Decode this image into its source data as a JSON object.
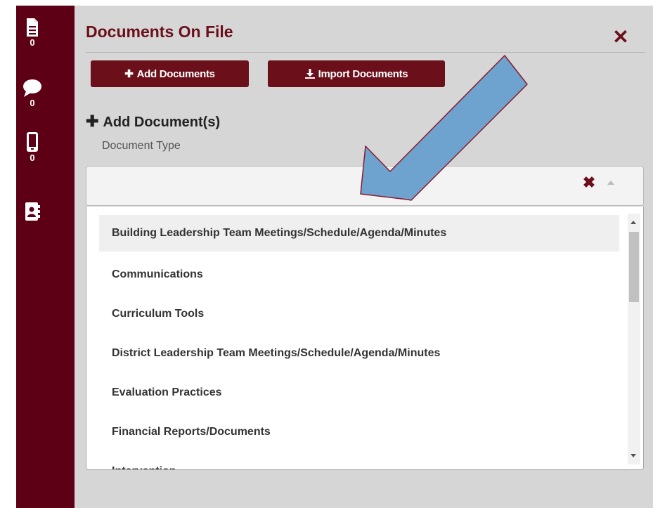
{
  "sidebar": {
    "documents_count": "0",
    "messages_count": "0",
    "mobile_count": "0"
  },
  "panel": {
    "title": "Documents On File",
    "close_glyph": "✕"
  },
  "buttons": {
    "add_documents": "Add Documents",
    "import_documents": "Import Documents"
  },
  "section": {
    "title": "Add Document(s)",
    "document_type_label": "Document Type"
  },
  "select": {
    "clear_glyph": "✖",
    "options": [
      "Building Leadership Team Meetings/Schedule/Agenda/Minutes",
      "Communications",
      "Curriculum Tools",
      "District Leadership Team Meetings/Schedule/Agenda/Minutes",
      "Evaluation Practices",
      "Financial Reports/Documents",
      "Intervention"
    ],
    "highlighted_index": 0
  },
  "colors": {
    "brand_maroon": "#6b0f1a",
    "sidebar_bg": "#5e0015",
    "panel_bg": "#d6d6d6",
    "annotation_arrow_fill": "#6fa3cf",
    "annotation_arrow_stroke": "#8b1a2a"
  },
  "icons": {
    "sidebar": [
      "document-icon",
      "chat-bubble-icon",
      "mobile-phone-icon",
      "contact-book-icon"
    ],
    "buttons": [
      "plus-icon",
      "download-icon"
    ]
  }
}
